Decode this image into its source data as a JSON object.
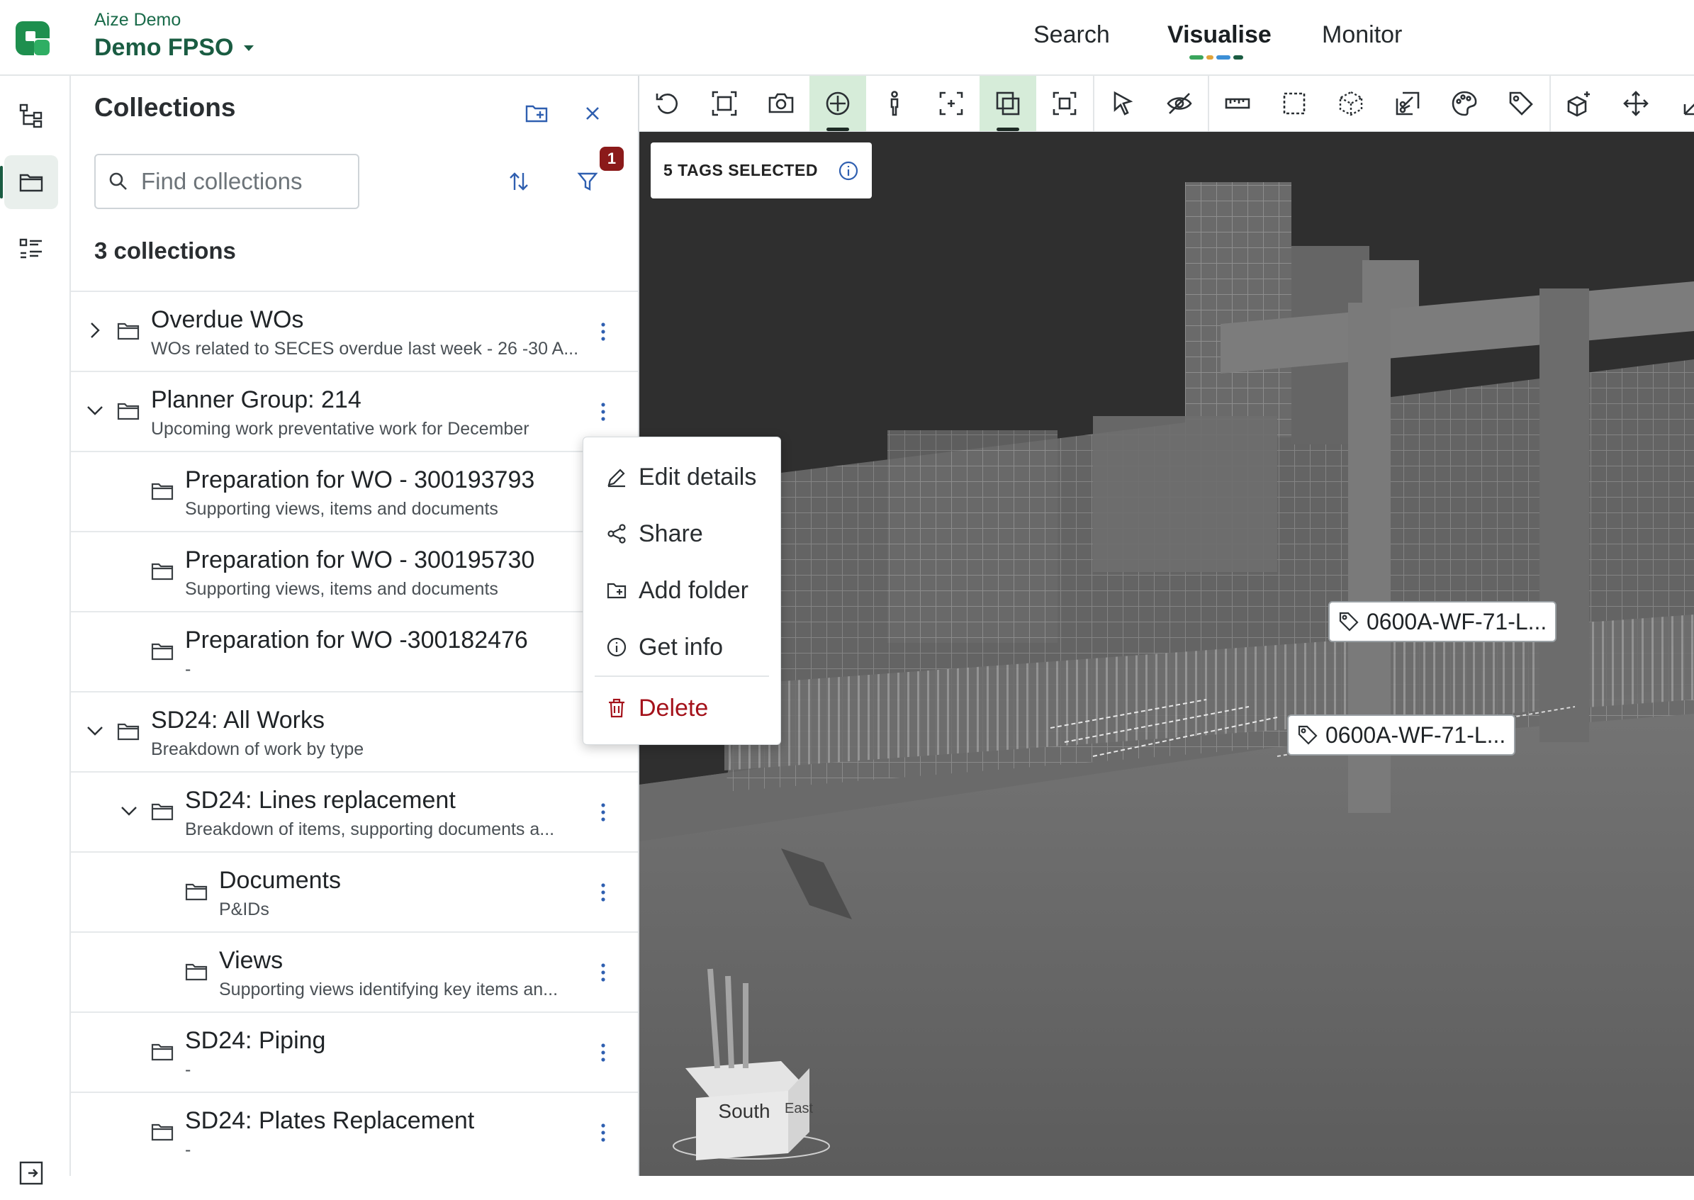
{
  "header": {
    "org_name": "Aize Demo",
    "project_name": "Demo FPSO",
    "nav": [
      {
        "label": "Search",
        "active": false
      },
      {
        "label": "Visualise",
        "active": true
      },
      {
        "label": "Monitor",
        "active": false
      }
    ],
    "nav_underline_colors": [
      "#3aa55c",
      "#e0a33a",
      "#3c8fd6",
      "#1a5c42"
    ]
  },
  "rail": {
    "items": [
      {
        "icon": "hierarchy-icon",
        "active": false
      },
      {
        "icon": "folder-icon",
        "active": true
      },
      {
        "icon": "list-icon",
        "active": false
      }
    ]
  },
  "collections": {
    "title": "Collections",
    "search_placeholder": "Find collections",
    "filter_badge": "1",
    "count_label": "3 collections",
    "items": [
      {
        "title": "Overdue WOs",
        "subtitle": "WOs related to SECES overdue last week - 26 -30 A...",
        "depth": 0,
        "chevron": "right"
      },
      {
        "title": "Planner Group: 214",
        "subtitle": "Upcoming work preventative work for December",
        "depth": 0,
        "chevron": "down"
      },
      {
        "title": "Preparation for WO - 300193793",
        "subtitle": "Supporting views, items and documents",
        "depth": 1,
        "chevron": "none"
      },
      {
        "title": "Preparation for WO - 300195730",
        "subtitle": "Supporting views, items and documents",
        "depth": 1,
        "chevron": "none"
      },
      {
        "title": "Preparation for WO -300182476",
        "subtitle": "-",
        "depth": 1,
        "chevron": "none"
      },
      {
        "title": "SD24: All Works",
        "subtitle": "Breakdown of work by type",
        "depth": 0,
        "chevron": "down"
      },
      {
        "title": "SD24: Lines replacement",
        "subtitle": "Breakdown of items, supporting documents a...",
        "depth": 1,
        "chevron": "down"
      },
      {
        "title": "Documents",
        "subtitle": "P&IDs",
        "depth": 2,
        "chevron": "none"
      },
      {
        "title": "Views",
        "subtitle": "Supporting views identifying key items an...",
        "depth": 2,
        "chevron": "none"
      },
      {
        "title": "SD24: Piping",
        "subtitle": "-",
        "depth": 1,
        "chevron": "none"
      },
      {
        "title": "SD24: Plates Replacement",
        "subtitle": "-",
        "depth": 1,
        "chevron": "none"
      }
    ]
  },
  "context_menu": {
    "items": [
      {
        "label": "Edit details",
        "icon": "pencil-icon"
      },
      {
        "label": "Share",
        "icon": "share-icon"
      },
      {
        "label": "Add folder",
        "icon": "add-folder-icon"
      },
      {
        "label": "Get info",
        "icon": "info-icon"
      },
      {
        "label": "Delete",
        "icon": "trash-icon",
        "danger": true
      }
    ]
  },
  "viewer": {
    "selection_label": "5 TAGS SELECTED",
    "tags": [
      "0600A-WF-71-L...",
      "0600A-WF-71-L..."
    ],
    "view_cube": {
      "front": "South",
      "right": "East"
    },
    "toolbar_tools": [
      "undo-icon",
      "fit-view-icon",
      "camera-icon",
      "orbit-icon",
      "walk-icon",
      "focus-icon",
      "multi-select-icon",
      "crop-icon",
      "select-icon",
      "hide-icon",
      "measure-icon",
      "box-select-icon",
      "section-box-icon",
      "clip-icon",
      "palette-icon",
      "tag-icon",
      "add-object-icon",
      "move-icon",
      "ruler-icon"
    ]
  }
}
